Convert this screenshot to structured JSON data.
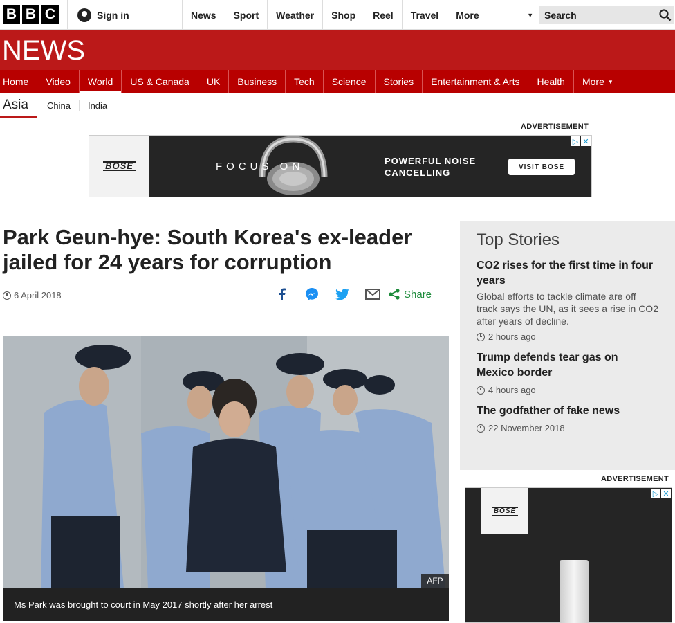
{
  "topbar": {
    "logo_letters": [
      "B",
      "B",
      "C"
    ],
    "signin_label": "Sign in",
    "nav": [
      "News",
      "Sport",
      "Weather",
      "Shop",
      "Reel",
      "Travel"
    ],
    "more_label": "More",
    "search_placeholder": "Search"
  },
  "banner": {
    "title": "NEWS",
    "color": "#bb1919"
  },
  "section_nav": {
    "items": [
      "Home",
      "Video",
      "World",
      "US & Canada",
      "UK",
      "Business",
      "Tech",
      "Science",
      "Stories",
      "Entertainment & Arts",
      "Health"
    ],
    "active": "World",
    "more_label": "More"
  },
  "sub_nav": {
    "current": "Asia",
    "items": [
      "China",
      "India"
    ]
  },
  "ad_top": {
    "label": "ADVERTISEMENT",
    "brand": "BOSE",
    "tagline": "FOCUS ON",
    "headline_line1": "POWERFUL NOISE",
    "headline_line2": "CANCELLING",
    "cta": "VISIT BOSE"
  },
  "article": {
    "headline": "Park Geun-hye: South Korea's ex-leader jailed for 24 years for corruption",
    "date": "6 April 2018",
    "share_label": "Share",
    "share_icons": [
      "facebook-icon",
      "messenger-icon",
      "twitter-icon",
      "email-icon",
      "share-icon"
    ],
    "photo_credit": "AFP",
    "caption": "Ms Park was brought to court in May 2017 shortly after her arrest"
  },
  "top_stories": {
    "title": "Top Stories",
    "stories": [
      {
        "headline": "CO2 rises for the first time in four years",
        "summary": "Global efforts to tackle climate are off track says the UN, as it sees a rise in CO2 after years of decline.",
        "time": "2 hours ago"
      },
      {
        "headline": "Trump defends tear gas on Mexico border",
        "time": "4 hours ago"
      },
      {
        "headline": "The godfather of fake news",
        "time": "22 November 2018"
      }
    ]
  },
  "ad_side": {
    "label": "ADVERTISEMENT",
    "brand": "BOSE"
  }
}
